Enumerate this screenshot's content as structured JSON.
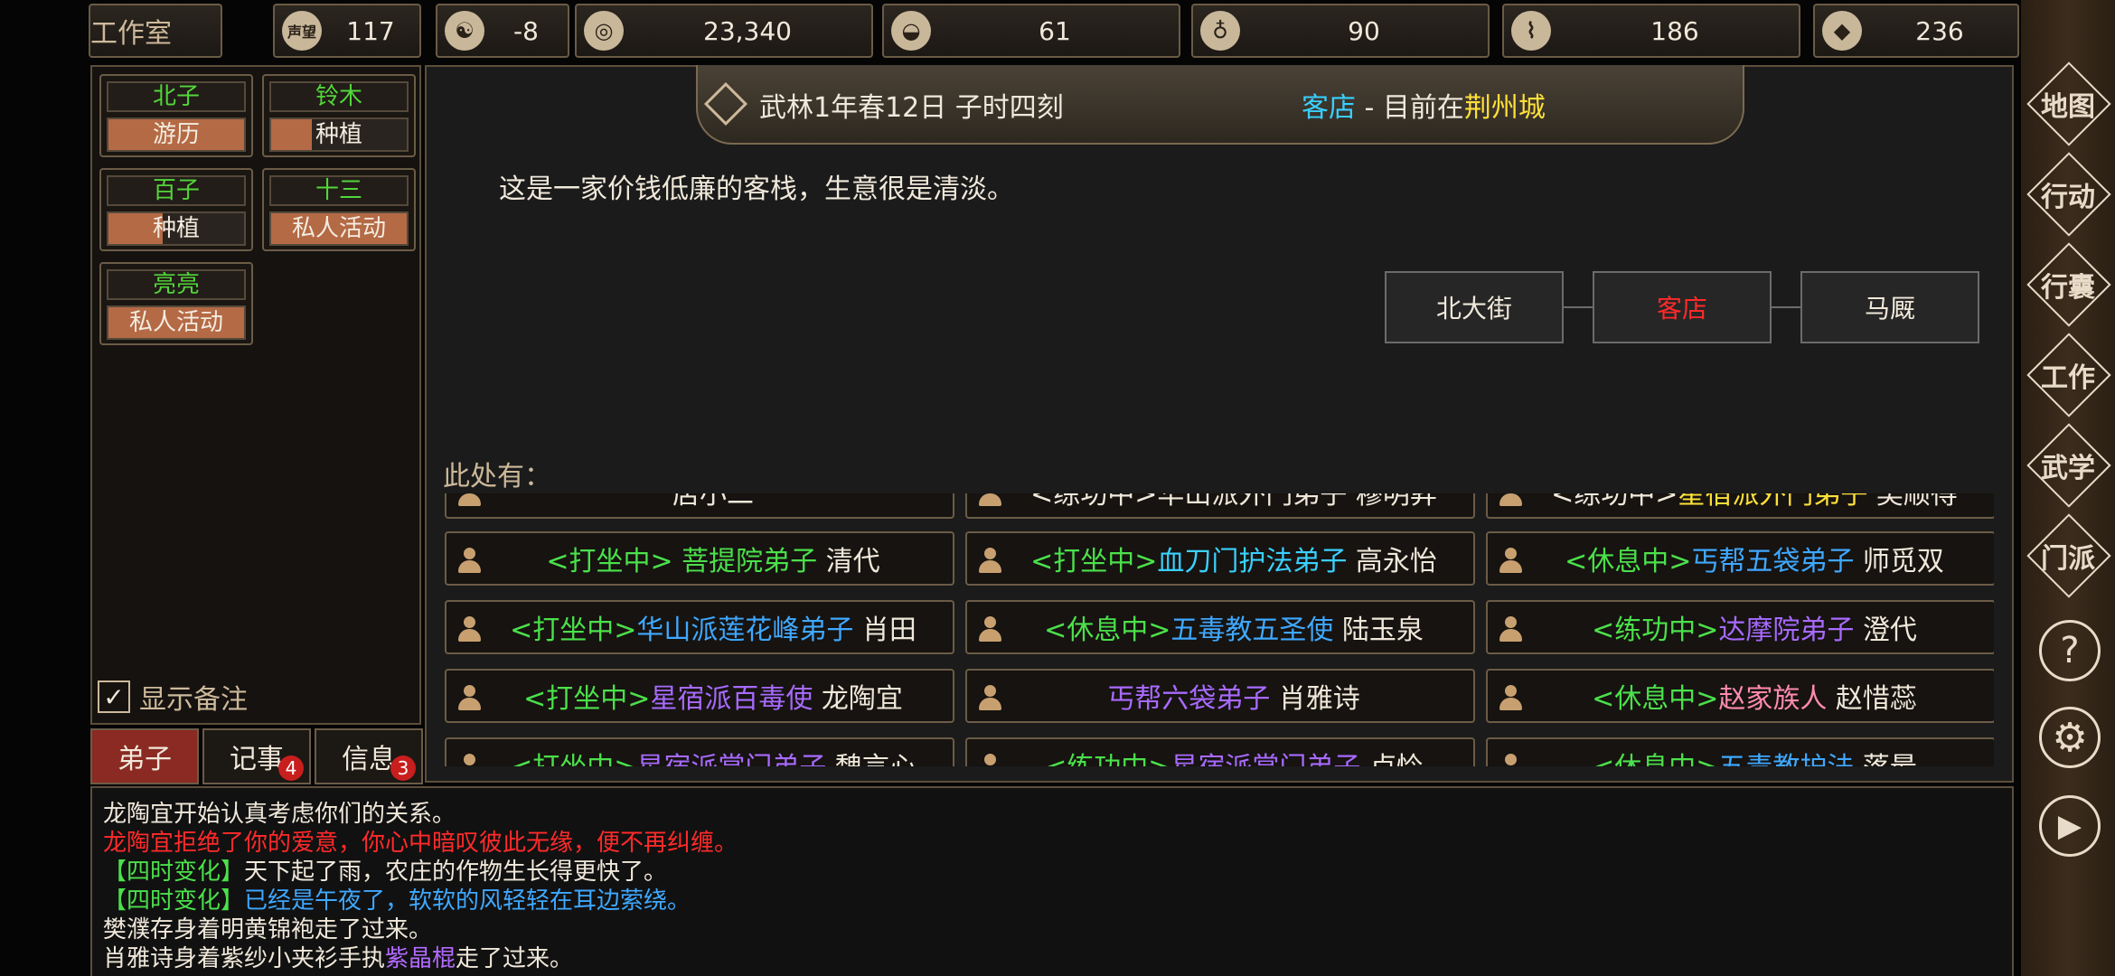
{
  "topbar": {
    "title": "工作室",
    "stats": [
      {
        "icon": "prestige-icon",
        "glyph": "声望",
        "value": "117"
      },
      {
        "icon": "yin-yang-icon",
        "glyph": "☯",
        "value": "-8"
      },
      {
        "icon": "coin-icon",
        "glyph": "◎",
        "value": "23,340"
      },
      {
        "icon": "food-bowl-icon",
        "glyph": "◒",
        "value": "61"
      },
      {
        "icon": "gourd-icon",
        "glyph": "♁",
        "value": "90"
      },
      {
        "icon": "wood-log-icon",
        "glyph": "⌇",
        "value": "186"
      },
      {
        "icon": "ore-rock-icon",
        "glyph": "◆",
        "value": "236"
      }
    ]
  },
  "disciples": [
    {
      "name": "北子",
      "activity": "游历",
      "progress": 1.0
    },
    {
      "name": "铃木",
      "activity": "种植",
      "progress": 0.3
    },
    {
      "name": "百子",
      "activity": "种植",
      "progress": 0.4
    },
    {
      "name": "十三",
      "activity": "私人活动",
      "progress": 1.0
    },
    {
      "name": "亮亮",
      "activity": "私人活动",
      "progress": 1.0
    }
  ],
  "show_remark_label": "显示备注",
  "bottom_tabs": [
    {
      "label": "弟子",
      "badge": ""
    },
    {
      "label": "记事",
      "badge": "4"
    },
    {
      "label": "信息",
      "badge": "3"
    }
  ],
  "header": {
    "date": "武林1年春12日 子时四刻",
    "place": "客店",
    "separator": " - ",
    "current_prefix": "目前在",
    "city": "荆州城"
  },
  "description": "这是一家价钱低廉的客栈，生意很是清淡。",
  "nav": {
    "left": "北大街",
    "center": "客店",
    "right": "马厩"
  },
  "here_label": "此处有：",
  "npcs_top_partial": [
    [
      "店小二"
    ],
    [
      "<练功中>",
      "华山派外门弟子",
      "穆明昇"
    ],
    [
      "<练功中>",
      "星宿派外门弟子",
      "吴顺得"
    ]
  ],
  "npcs": [
    {
      "state": "<打坐中>",
      "title": "菩提院弟子",
      "name": "清代",
      "title_color": "g"
    },
    {
      "state": "<打坐中>",
      "title": "血刀门护法弟子",
      "name": "高永怡",
      "title_color": "c"
    },
    {
      "state": "<休息中>",
      "title": "丐帮五袋弟子",
      "name": "师觅双",
      "title_color": "b"
    },
    {
      "state": "<打坐中>",
      "title": "华山派莲花峰弟子",
      "name": "肖田",
      "title_color": "b"
    },
    {
      "state": "<休息中>",
      "title": "五毒教五圣使",
      "name": "陆玉泉",
      "title_color": "b"
    },
    {
      "state": "<练功中>",
      "title": "达摩院弟子",
      "name": "澄代",
      "title_color": "p"
    },
    {
      "state": "<打坐中>",
      "title": "星宿派百毒使",
      "name": "龙陶宜",
      "title_color": "p"
    },
    {
      "state": "",
      "title": "丐帮六袋弟子",
      "name": "肖雅诗",
      "title_color": "p"
    },
    {
      "state": "<休息中>",
      "title": "赵家族人",
      "name": "赵惜蕊",
      "title_color": "pk"
    }
  ],
  "npcs_bottom_partial": [
    {
      "state": "<打坐中>",
      "title": "星宿派掌门弟子",
      "name": "魏言心"
    },
    {
      "state": "<练功中>",
      "title": "星宿派掌门弟子",
      "name": "卢怜"
    },
    {
      "state": "<休息中>",
      "title": "五毒教护法",
      "name": "落最"
    }
  ],
  "log": [
    {
      "parts": [
        {
          "t": "龙陶宜开始认真考虑你们的关系。",
          "c": "w"
        }
      ]
    },
    {
      "parts": [
        {
          "t": "龙陶宜拒绝了你的爱意，你心中暗叹彼此无缘，便不再纠缠。",
          "c": "r"
        }
      ]
    },
    {
      "parts": [
        {
          "t": "【四时变化】",
          "c": "lg"
        },
        {
          "t": "天下起了雨，农庄的作物生长得更快了。",
          "c": "w"
        }
      ]
    },
    {
      "parts": [
        {
          "t": "【四时变化】",
          "c": "lg"
        },
        {
          "t": "已经是午夜了，软软的风轻轻在耳边萦绕。",
          "c": "lb"
        }
      ]
    },
    {
      "parts": [
        {
          "t": "樊濮存身着明黄锦袍走了过来。",
          "c": "w"
        }
      ]
    },
    {
      "parts": [
        {
          "t": "肖雅诗身着紫纱小夹衫手执",
          "c": "w"
        },
        {
          "t": "紫晶棍",
          "c": "lp"
        },
        {
          "t": "走了过来。",
          "c": "w"
        }
      ]
    }
  ],
  "right_menu": [
    "地图",
    "行动",
    "行囊",
    "工作",
    "武学",
    "门派"
  ],
  "right_menu_icons": [
    "help-icon",
    "gear-icon",
    "play-icon"
  ],
  "colors": {
    "accent_gold": "#cdb99a",
    "progress": "#b46a45",
    "active_tab": "#8a2a22"
  }
}
